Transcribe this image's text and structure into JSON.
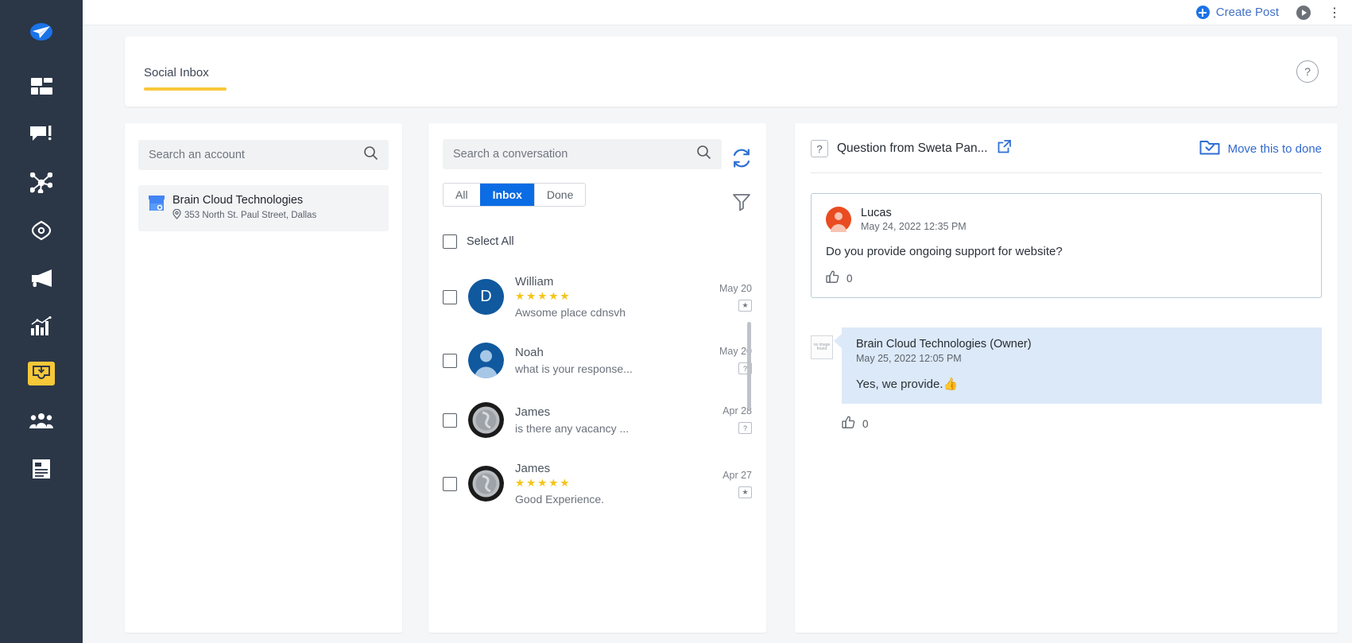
{
  "nav": {
    "logo_icon": "paper-plane-logo",
    "items": [
      {
        "icon": "dashboard-icon",
        "name": "dashboard",
        "active": false
      },
      {
        "icon": "comment-edit-icon",
        "name": "reviews",
        "active": false
      },
      {
        "icon": "network-share-icon",
        "name": "social",
        "active": false
      },
      {
        "icon": "compass-icon",
        "name": "local-seo",
        "active": false
      },
      {
        "icon": "megaphone-icon",
        "name": "campaigns",
        "active": false
      },
      {
        "icon": "bar-chart-icon",
        "name": "analytics",
        "active": false
      },
      {
        "icon": "inbox-download-icon",
        "name": "social-inbox",
        "active": true
      },
      {
        "icon": "users-group-icon",
        "name": "customers",
        "active": false
      },
      {
        "icon": "document-list-icon",
        "name": "reports",
        "active": false
      }
    ]
  },
  "topbar": {
    "create_post_label": "Create Post",
    "create_post_icon": "plus-circle-icon",
    "play_icon": "play-circle-icon",
    "edge_icon": "partial-icon"
  },
  "page": {
    "tab_label": "Social Inbox",
    "help_label": "?"
  },
  "accounts": {
    "search_placeholder": "Search an account",
    "search_value": "",
    "search_icon": "search-icon",
    "selected": {
      "name": "Brain Cloud Technologies",
      "address": "353 North St. Paul Street, Dallas",
      "logo_icon": "google-business-icon",
      "pin_icon": "map-pin-icon"
    }
  },
  "conversations": {
    "search_placeholder": "Search a conversation",
    "search_value": "",
    "search_icon": "search-icon",
    "refresh_icon": "refresh-icon",
    "filter_icon": "filter-icon",
    "filters": [
      {
        "label": "All",
        "active": false
      },
      {
        "label": "Inbox",
        "active": true
      },
      {
        "label": "Done",
        "active": false
      }
    ],
    "select_all_label": "Select All",
    "items": [
      {
        "name": "William",
        "avatar_type": "initial",
        "avatar_initial": "D",
        "avatar_color": "#10599e",
        "rating": 5,
        "snippet": "Awsome place cdnsvh",
        "date": "May 20",
        "badge_icon": "review-badge-icon",
        "checked": false
      },
      {
        "name": "Noah",
        "avatar_type": "silhouette",
        "avatar_initial": "",
        "avatar_color": "#10599e",
        "rating": 0,
        "snippet": "what is your response...",
        "date": "May 20",
        "badge_icon": "question-badge-icon",
        "checked": false
      },
      {
        "name": "James",
        "avatar_type": "photo",
        "avatar_initial": "",
        "avatar_color": "#8d9298",
        "rating": 0,
        "snippet": "is there any vacancy ...",
        "date": "Apr 28",
        "badge_icon": "question-badge-icon",
        "checked": false
      },
      {
        "name": "James",
        "avatar_type": "photo",
        "avatar_initial": "",
        "avatar_color": "#8d9298",
        "rating": 5,
        "snippet": "Good Experience.",
        "date": "Apr 27",
        "badge_icon": "review-badge-icon",
        "checked": false
      }
    ]
  },
  "detail": {
    "badge_label": "?",
    "title": "Question from Sweta Pan...",
    "external_link_icon": "external-link-icon",
    "move_done_label": "Move this to done",
    "move_done_icon": "folder-check-icon",
    "message": {
      "author": "Lucas",
      "time": "May 24, 2022 12:35 PM",
      "text": "Do you provide ongoing support for website?",
      "like_icon": "thumbs-up-icon",
      "like_count": "0",
      "avatar_color": "#ea4b21"
    },
    "reply": {
      "author": "Brain Cloud Technologies (Owner)",
      "time": "May 25, 2022 12:05 PM",
      "text": "Yes, we provide.👍",
      "like_icon": "thumbs-up-icon",
      "like_count": "0",
      "thumb_alt": "no image found"
    }
  },
  "colors": {
    "rail_bg": "#2b3647",
    "accent_yellow": "#f7c838",
    "accent_blue": "#0b6ce4",
    "link_blue": "#3269cd",
    "star_yellow": "#f5c518",
    "reply_bubble": "#dce9f8"
  }
}
